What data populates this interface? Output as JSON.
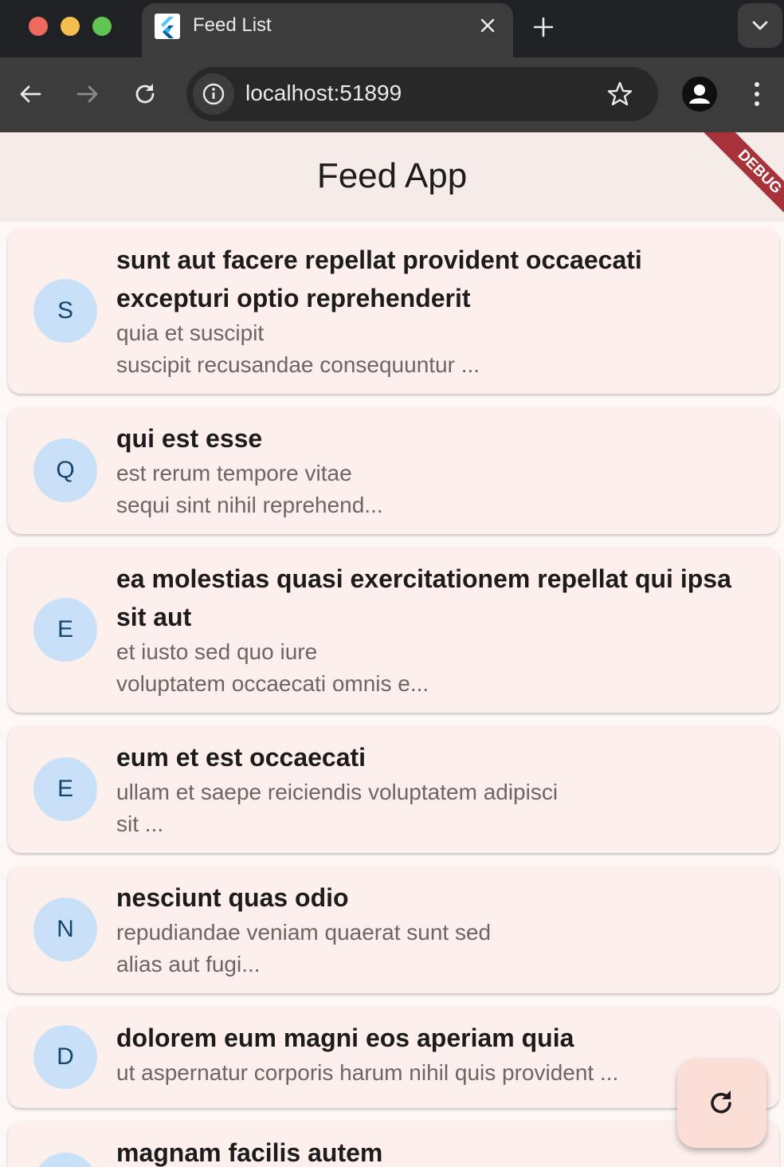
{
  "browser": {
    "tab_title": "Feed List",
    "url": "localhost:51899"
  },
  "app": {
    "title": "Feed App",
    "debug_label": "DEBUG"
  },
  "posts": [
    {
      "initial": "S",
      "title": "sunt aut facere repellat provident occaecati excepturi optio reprehenderit",
      "excerpt": "quia et suscipit\nsuscipit recusandae consequuntur ..."
    },
    {
      "initial": "Q",
      "title": "qui est esse",
      "excerpt": "est rerum tempore vitae\nsequi sint nihil reprehend..."
    },
    {
      "initial": "E",
      "title": "ea molestias quasi exercitationem repellat qui ipsa sit aut",
      "excerpt": "et iusto sed quo iure\nvoluptatem occaecati omnis e..."
    },
    {
      "initial": "E",
      "title": "eum et est occaecati",
      "excerpt": "ullam et saepe reiciendis voluptatem adipisci\nsit ..."
    },
    {
      "initial": "N",
      "title": "nesciunt quas odio",
      "excerpt": "repudiandae veniam quaerat sunt sed\nalias aut fugi..."
    },
    {
      "initial": "D",
      "title": "dolorem eum magni eos aperiam quia",
      "excerpt": "ut aspernatur corporis harum nihil quis provident ..."
    },
    {
      "initial": "",
      "title": "magnam facilis autem",
      "excerpt": ""
    }
  ],
  "icons": {
    "favicon": "flutter-icon",
    "close": "close-icon",
    "new_tab": "plus-icon",
    "tab_menu": "chevron-down-icon",
    "back": "arrow-left-icon",
    "forward": "arrow-right-icon",
    "reload": "reload-icon",
    "site_info": "info-icon",
    "bookmark": "star-icon",
    "profile": "profile-icon",
    "menu": "more-vertical-icon",
    "fab": "refresh-icon"
  },
  "colors": {
    "card_background": "#fcefec",
    "avatar_background": "#c8e1f8",
    "avatar_text": "#17456c",
    "fab_background": "#fbded5",
    "debug_ribbon": "#a8323a"
  }
}
